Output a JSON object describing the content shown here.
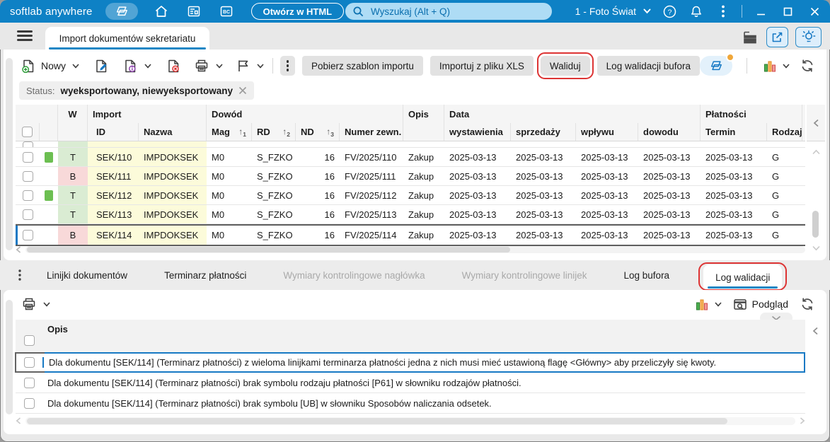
{
  "titlebar": {
    "app_name": "softlab anywhere",
    "bc_label": "BC",
    "open_in_html": "Otwórz w HTML",
    "search_placeholder": "Wyszukaj (Alt + Q)",
    "company": "1 - Foto Świat"
  },
  "main_tab": "Import dokumentów sekretariatu",
  "toolbar": {
    "new_label": "Nowy",
    "actions": [
      {
        "label": "Pobierz szablon importu",
        "annotated": false
      },
      {
        "label": "Importuj z pliku XLS",
        "annotated": false
      },
      {
        "label": "Waliduj",
        "annotated": true
      },
      {
        "label": "Log walidacji bufora",
        "annotated": false
      }
    ]
  },
  "filter": {
    "label": "Status:",
    "value": "wyeksportowany, niewyeksportowany"
  },
  "grid": {
    "group_headers": {
      "w": "W",
      "import": "Import",
      "dowod": "Dowód",
      "opis": "Opis",
      "data": "Data",
      "platnosci": "Płatności"
    },
    "col_headers": {
      "id": "ID",
      "nazwa": "Nazwa",
      "mag": "Mag",
      "rd": "RD",
      "nd": "ND",
      "numer": "Numer zewn.",
      "wystawienia": "wystawienia",
      "sprzedazy": "sprzedaży",
      "wplywu": "wpływu",
      "dowodu": "dowodu",
      "termin": "Termin",
      "rodzaj": "Rodzaj"
    },
    "sort_arrow": "↑",
    "sort_orders": [
      "1",
      "2",
      "3"
    ],
    "rows": [
      {
        "selected": false,
        "swatch": true,
        "w": "T",
        "id": "SEK/110",
        "name": "IMPDOKSEK",
        "mag": "M0",
        "rd": "S_FZKO",
        "nd": "16",
        "ext": "FV/2025/110",
        "desc": "Zakup",
        "d1": "2025-03-13",
        "d2": "2025-03-13",
        "d3": "2025-03-13",
        "d4": "2025-03-13",
        "term": "2025-03-13",
        "type": "G"
      },
      {
        "selected": false,
        "swatch": false,
        "w": "B",
        "id": "SEK/111",
        "name": "IMPDOKSEK",
        "mag": "M0",
        "rd": "S_FZKO",
        "nd": "16",
        "ext": "FV/2025/111",
        "desc": "Zakup",
        "d1": "2025-03-13",
        "d2": "2025-03-13",
        "d3": "2025-03-13",
        "d4": "2025-03-13",
        "term": "2025-03-13",
        "type": "G"
      },
      {
        "selected": false,
        "swatch": true,
        "w": "T",
        "id": "SEK/112",
        "name": "IMPDOKSEK",
        "mag": "M0",
        "rd": "S_FZKO",
        "nd": "16",
        "ext": "FV/2025/112",
        "desc": "Zakup",
        "d1": "2025-03-13",
        "d2": "2025-03-13",
        "d3": "2025-03-13",
        "d4": "2025-03-13",
        "term": "2025-03-13",
        "type": "G"
      },
      {
        "selected": false,
        "swatch": false,
        "w": "T",
        "id": "SEK/113",
        "name": "IMPDOKSEK",
        "mag": "M0",
        "rd": "S_FZKO",
        "nd": "16",
        "ext": "FV/2025/113",
        "desc": "Zakup",
        "d1": "2025-03-13",
        "d2": "2025-03-13",
        "d3": "2025-03-13",
        "d4": "2025-03-13",
        "term": "2025-03-13",
        "type": "G"
      },
      {
        "selected": true,
        "swatch": false,
        "w": "B",
        "id": "SEK/114",
        "name": "IMPDOKSEK",
        "mag": "M0",
        "rd": "S_FZKO",
        "nd": "16",
        "ext": "FV/2025/114",
        "desc": "Zakup",
        "d1": "2025-03-13",
        "d2": "2025-03-13",
        "d3": "2025-03-13",
        "d4": "2025-03-13",
        "term": "2025-03-13",
        "type": "G"
      }
    ]
  },
  "detail_tabs": [
    {
      "label": "Linijki dokumentów",
      "disabled": false,
      "active": false,
      "annotated": false
    },
    {
      "label": "Terminarz płatności",
      "disabled": false,
      "active": false,
      "annotated": false
    },
    {
      "label": "Wymiary kontrolingowe nagłówka",
      "disabled": true,
      "active": false,
      "annotated": false
    },
    {
      "label": "Wymiary kontrolingowe linijek",
      "disabled": true,
      "active": false,
      "annotated": false
    },
    {
      "label": "Log bufora",
      "disabled": false,
      "active": false,
      "annotated": false
    },
    {
      "label": "Log walidacji",
      "disabled": false,
      "active": true,
      "annotated": true
    }
  ],
  "log": {
    "preview_label": "Podgląd",
    "header": "Opis",
    "rows": [
      {
        "selected": true,
        "text": "Dla dokumentu [SEK/114] (Terminarz płatności) z wieloma linijkami terminarza płatności jedna z nich musi mieć ustawioną flagę <Główny> aby przeliczyły się kwoty."
      },
      {
        "selected": false,
        "text": "Dla dokumentu [SEK/114] (Terminarz płatności) brak symbolu rodzaju płatności [P61] w słowniku rodzajów płatności."
      },
      {
        "selected": false,
        "text": "Dla dokumentu [SEK/114] (Terminarz płatności) brak symbolu [UB] w słowniku Sposobów naliczania odsetek."
      }
    ]
  },
  "colors": {
    "titlebar": "#0e81c5",
    "accent": "#1e87c5",
    "annotation": "#dd3434",
    "status_green": "#daecd3",
    "status_pink": "#f8d9d9",
    "cell_yellow": "#fcfbda",
    "swatch_green": "#6cbf51"
  }
}
